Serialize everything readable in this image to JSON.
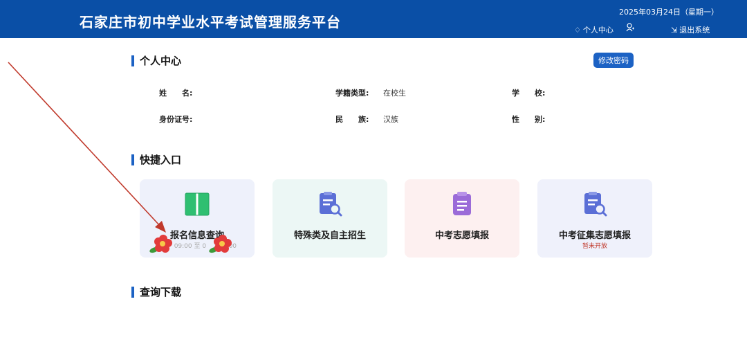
{
  "header": {
    "title": "石家庄市初中学业水平考试管理服务平台",
    "date": "2025年03月24日（星期一）",
    "personal_center": "个人中心",
    "logout": "退出系统",
    "bg_color": "#0a4fa6"
  },
  "profile": {
    "title": "个人中心",
    "change_password": "修改密码",
    "fields": {
      "name_label": "姓　　名:",
      "name_value": "",
      "status_label": "学籍类型:",
      "status_value": "在校生",
      "school_label": "学　　校:",
      "school_value": "",
      "id_label": "身份证号:",
      "id_value": "",
      "ethnic_label": "民　　族:",
      "ethnic_value": "汉族",
      "gender_label": "性　　别:",
      "gender_value": ""
    }
  },
  "shortcuts": {
    "title": "快捷入口",
    "cards": [
      {
        "label": "报名信息查询",
        "sub": "0　　09:00 至 0　　17:00",
        "icon": "book-icon",
        "bg": "#eef1fb"
      },
      {
        "label": "特殊类及自主招生",
        "sub": "",
        "icon": "document-search-icon",
        "bg": "#ecf7f5"
      },
      {
        "label": "中考志愿填报",
        "sub": "",
        "icon": "clipboard-icon",
        "bg": "#fdf0f0"
      },
      {
        "label": "中考征集志愿填报",
        "sub": "暂未开放",
        "icon": "document-search-icon",
        "bg": "#eff1fb"
      }
    ]
  },
  "query": {
    "title": "查询下载"
  },
  "annotation": {
    "arrow_color": "#c0392b"
  }
}
